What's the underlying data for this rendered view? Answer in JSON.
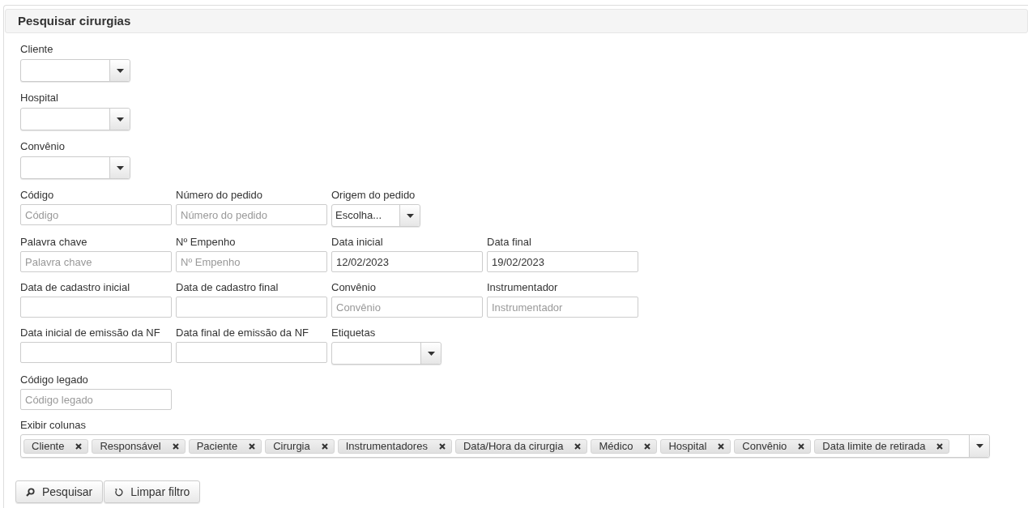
{
  "title": "Pesquisar cirurgias",
  "top_selects": [
    {
      "label": "Cliente"
    },
    {
      "label": "Hospital"
    },
    {
      "label": "Convênio"
    }
  ],
  "field_rows": [
    [
      {
        "kind": "text",
        "label": "Código",
        "placeholder": "Código"
      },
      {
        "kind": "text",
        "label": "Número do pedido",
        "placeholder": "Número do pedido"
      },
      {
        "kind": "select_small",
        "label": "Origem do pedido",
        "value": "Escolha..."
      }
    ],
    [
      {
        "kind": "text",
        "label": "Palavra chave",
        "placeholder": "Palavra chave"
      },
      {
        "kind": "text",
        "label": "Nº Empenho",
        "placeholder": "Nº Empenho"
      },
      {
        "kind": "text",
        "label": "Data inicial",
        "value": "12/02/2023"
      },
      {
        "kind": "text",
        "label": "Data final",
        "value": "19/02/2023"
      }
    ],
    [
      {
        "kind": "text",
        "label": "Data de cadastro inicial"
      },
      {
        "kind": "text",
        "label": "Data de cadastro final"
      },
      {
        "kind": "text",
        "label": "Convênio",
        "placeholder": "Convênio"
      },
      {
        "kind": "text",
        "label": "Instrumentador",
        "placeholder": "Instrumentador"
      }
    ],
    [
      {
        "kind": "text",
        "label": "Data inicial de emissão da NF"
      },
      {
        "kind": "text",
        "label": "Data final de emissão da NF"
      },
      {
        "kind": "select",
        "label": "Etiquetas"
      }
    ],
    [
      {
        "kind": "text",
        "label": "Código legado",
        "placeholder": "Código legado"
      }
    ]
  ],
  "columns": {
    "label": "Exibir colunas",
    "tags": [
      "Cliente",
      "Responsável",
      "Paciente",
      "Cirurgia",
      "Instrumentadores",
      "Data/Hora da cirurgia",
      "Médico",
      "Hospital",
      "Convênio",
      "Data limite de retirada"
    ]
  },
  "buttons": [
    {
      "kind": "search",
      "label": "Pesquisar"
    },
    {
      "kind": "reset",
      "label": "Limpar filtro"
    }
  ]
}
